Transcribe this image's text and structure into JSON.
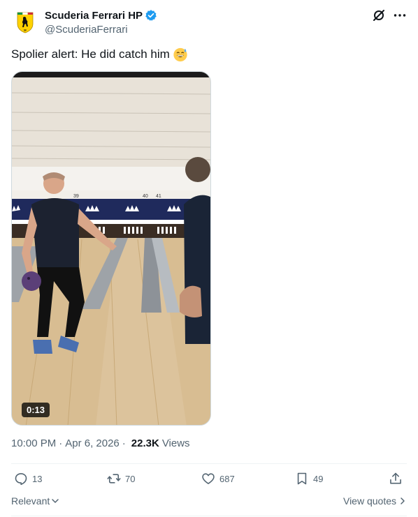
{
  "author": {
    "display_name": "Scuderia Ferrari HP",
    "handle": "@ScuderiaFerrari"
  },
  "tweet": {
    "text": "Spolier alert: He did catch him"
  },
  "media": {
    "duration": "0:13",
    "lane_numbers": [
      "39",
      "40",
      "41"
    ]
  },
  "meta": {
    "time": "10:00 PM",
    "date": "Apr 6, 2026",
    "views_count": "22.3K",
    "views_label": "Views"
  },
  "actions": {
    "replies": "13",
    "reposts": "70",
    "likes": "687",
    "bookmarks": "49"
  },
  "footer": {
    "relevant_label": "Relevant",
    "view_quotes_label": "View quotes"
  },
  "colors": {
    "verified": "#1d9bf0",
    "secondary_text": "#536471",
    "ferrari_yellow": "#ffd200"
  }
}
